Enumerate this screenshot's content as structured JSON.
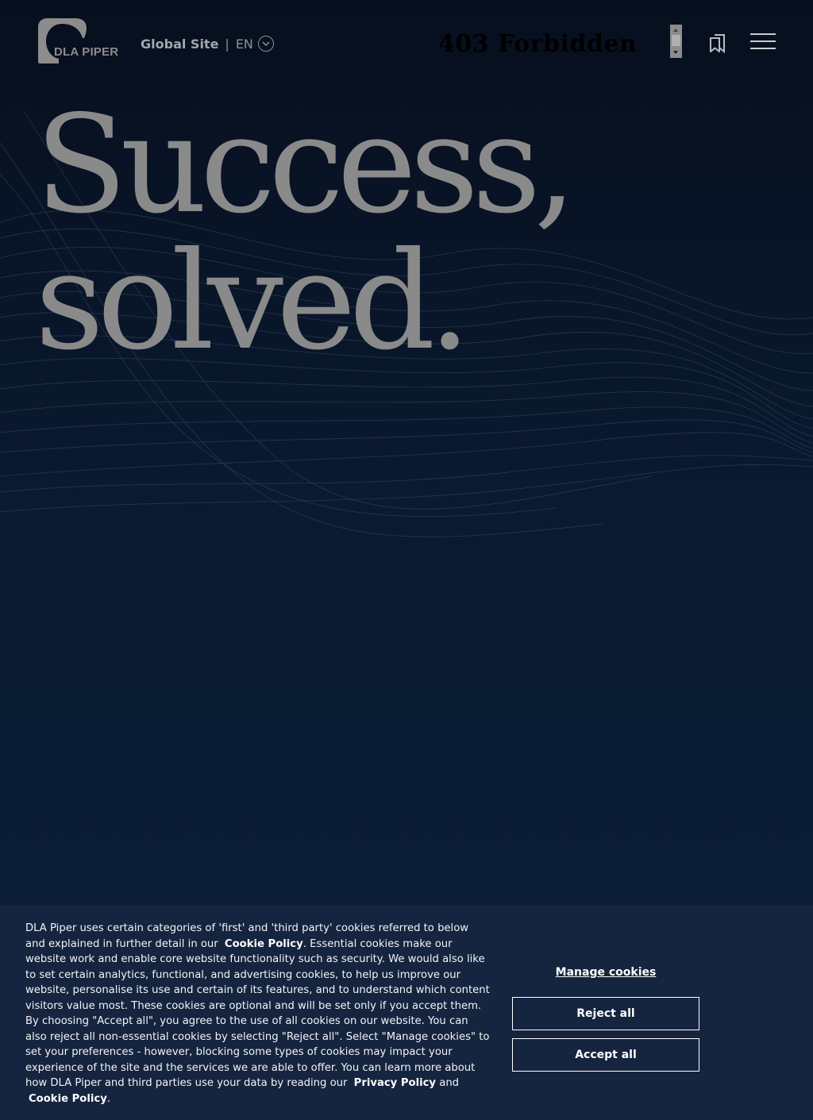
{
  "header": {
    "logo_text": "DLA PIPER",
    "site_label": "Global Site",
    "separator": "|",
    "language": "EN",
    "error_text": "403 Forbidden",
    "icons": [
      "chevron-down-icon",
      "bookmark-icon",
      "hamburger-menu-icon"
    ]
  },
  "hero": {
    "line1": "Success,",
    "line2": "solved."
  },
  "cookie_banner": {
    "text_1": "DLA Piper uses certain categories of 'first' and 'third party' cookies referred to below and explained in further detail in our",
    "link_cookie_policy": "Cookie Policy",
    "text_2": ". Essential cookies make our website work and enable core website functionality such as security. We would also like to set certain analytics, functional, and advertising cookies, to help us improve our website, personalise its use and certain of its features, and to understand which content visitors value most. These cookies are optional and will be set only if you accept them. By choosing \"Accept all\", you agree to the use of all cookies on our website. You can also reject all non-essential cookies by selecting \"Reject all\". Select \"Manage cookies\" to set your preferences - however, blocking some types of cookies may impact your experience of the site and the services we are able to offer. You can learn more about how DLA Piper and third parties use your data by reading our",
    "link_privacy_policy": "Privacy Policy",
    "text_and": "and",
    "link_cookie_policy_2": "Cookie Policy",
    "text_end": ".",
    "manage_label": "Manage cookies",
    "reject_label": "Reject all",
    "accept_label": "Accept all"
  },
  "colors": {
    "background": "#0a1a30",
    "banner": "#15243f",
    "hero_text": "#8a8a8a",
    "logo": "#8c8c8c"
  }
}
